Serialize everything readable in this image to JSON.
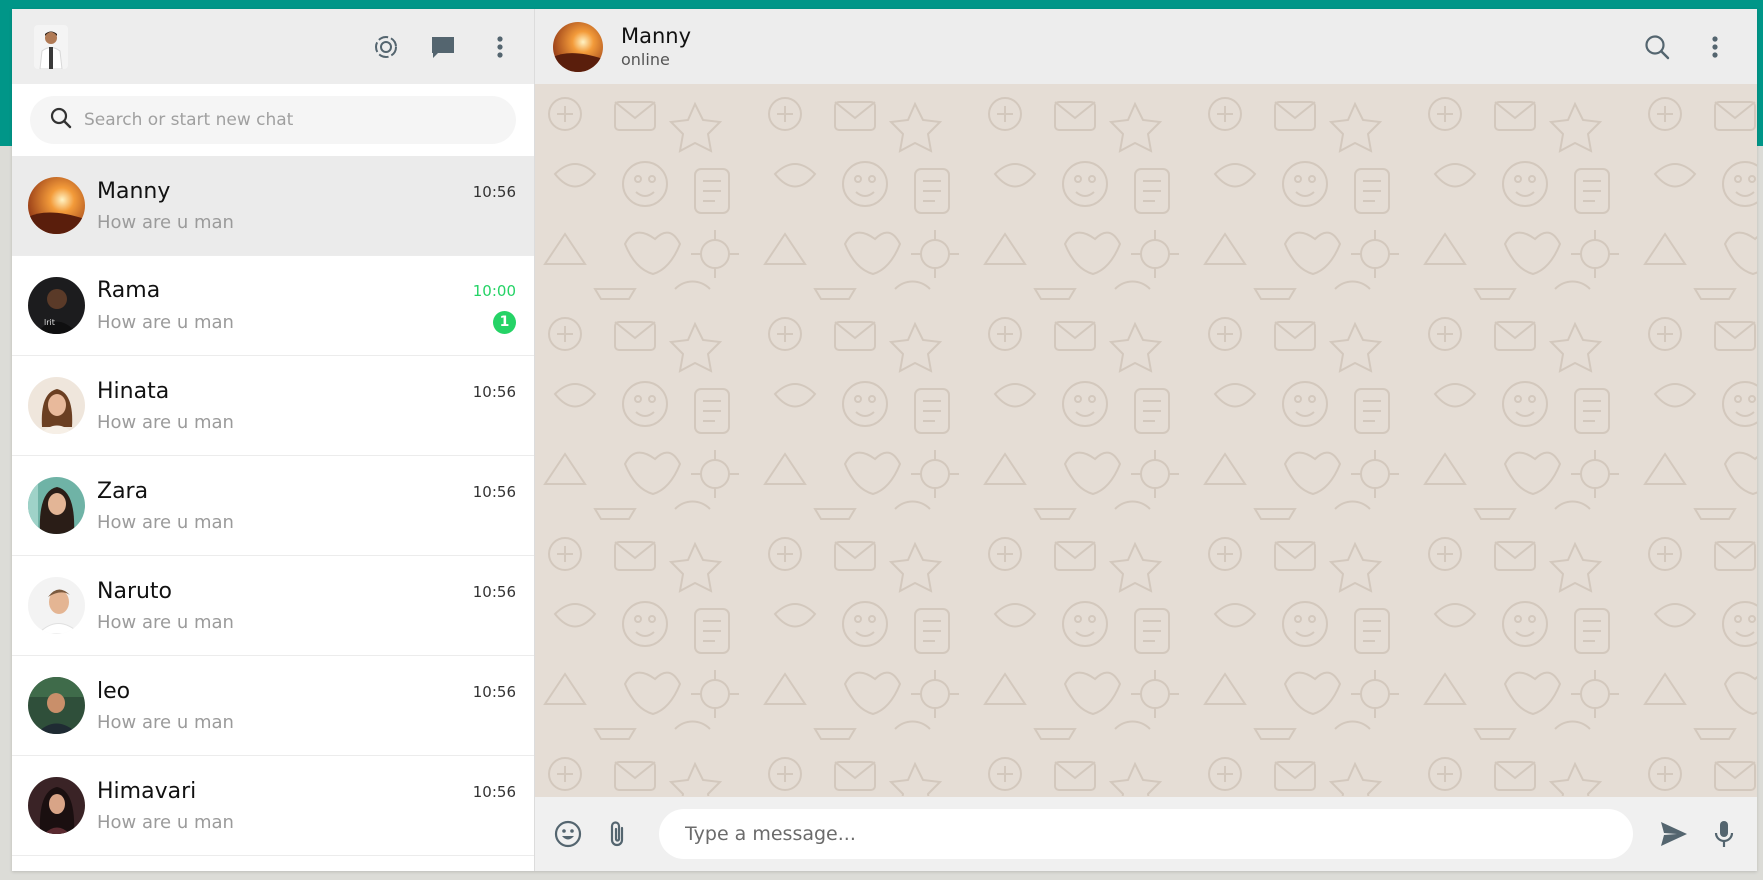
{
  "sidebar": {
    "header": {
      "my_avatar": "user-avatar",
      "icons": [
        "status-icon",
        "new-chat-icon",
        "menu-icon"
      ]
    },
    "search": {
      "placeholder": "Search or start new chat"
    },
    "chats": [
      {
        "name": "Manny",
        "message": "How are u man",
        "time": "10:56",
        "active": true
      },
      {
        "name": "Rama",
        "message": "How are u man",
        "time": "10:00",
        "unread": "1"
      },
      {
        "name": "Hinata",
        "message": "How are u man",
        "time": "10:56"
      },
      {
        "name": "Zara",
        "message": "How are u man",
        "time": "10:56"
      },
      {
        "name": "Naruto",
        "message": "How are u man",
        "time": "10:56"
      },
      {
        "name": "leo",
        "message": "How are u man",
        "time": "10:56"
      },
      {
        "name": "Himavari",
        "message": "How are u man",
        "time": "10:56"
      }
    ]
  },
  "conversation": {
    "contact_name": "Manny",
    "contact_status": "online",
    "input_placeholder": "Type a message..."
  },
  "colors": {
    "accent": "#009688",
    "unread": "#25d366",
    "chat_background": "#e5ddd5",
    "header_background": "#ededed"
  }
}
